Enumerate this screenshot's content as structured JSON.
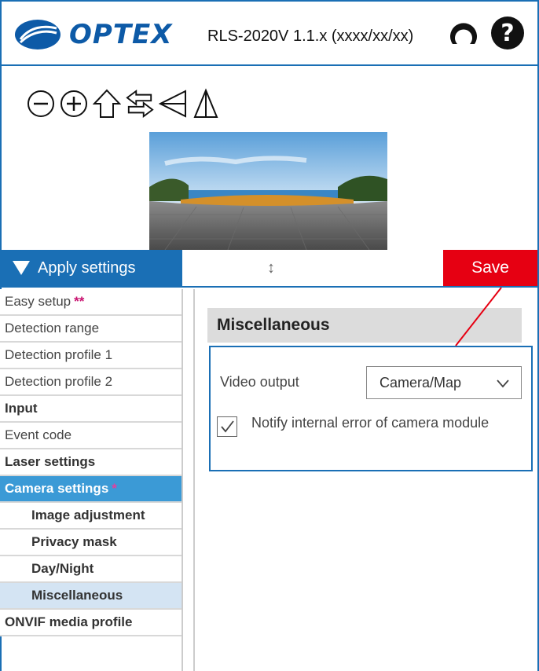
{
  "header": {
    "brand": "OPTEX",
    "version": "RLS-2020V 1.1.x (xxxx/xx/xx)",
    "icons": [
      "refresh-icon",
      "help-icon"
    ]
  },
  "camera": {
    "tools": [
      "zoom-out-icon",
      "zoom-in-icon",
      "home-icon",
      "swap-icon",
      "flip-horizontal-icon",
      "flip-vertical-icon"
    ]
  },
  "apply_bar": {
    "apply_label": "Apply settings",
    "splitter": "↕",
    "save_label": "Save"
  },
  "sidebar": {
    "items": [
      {
        "label": "Easy setup",
        "star": "**"
      },
      {
        "label": "Detection range",
        "star": ""
      },
      {
        "label": "Detection profile 1",
        "star": ""
      },
      {
        "label": "Detection profile 2",
        "star": ""
      },
      {
        "label": "Input",
        "star": ""
      },
      {
        "label": "Event code",
        "star": ""
      },
      {
        "label": "Laser settings",
        "star": ""
      },
      {
        "label": "Camera settings",
        "star": "*"
      },
      {
        "label": "Image adjustment",
        "star": ""
      },
      {
        "label": "Privacy mask",
        "star": ""
      },
      {
        "label": "Day/Night",
        "star": ""
      },
      {
        "label": "Miscellaneous",
        "star": ""
      },
      {
        "label": "ONVIF media profile",
        "star": ""
      }
    ]
  },
  "content": {
    "title": "Miscellaneous",
    "video_output": {
      "label": "Video output",
      "value": "Camera/Map"
    },
    "notify_error": {
      "label": "Notify internal error of camera module",
      "checked": true
    }
  },
  "colors": {
    "brand_blue": "#1a6fb5",
    "save_red": "#e60012",
    "active_item": "#3b9ad6",
    "selected_item": "#d4e4f3",
    "star": "#c8116f"
  }
}
